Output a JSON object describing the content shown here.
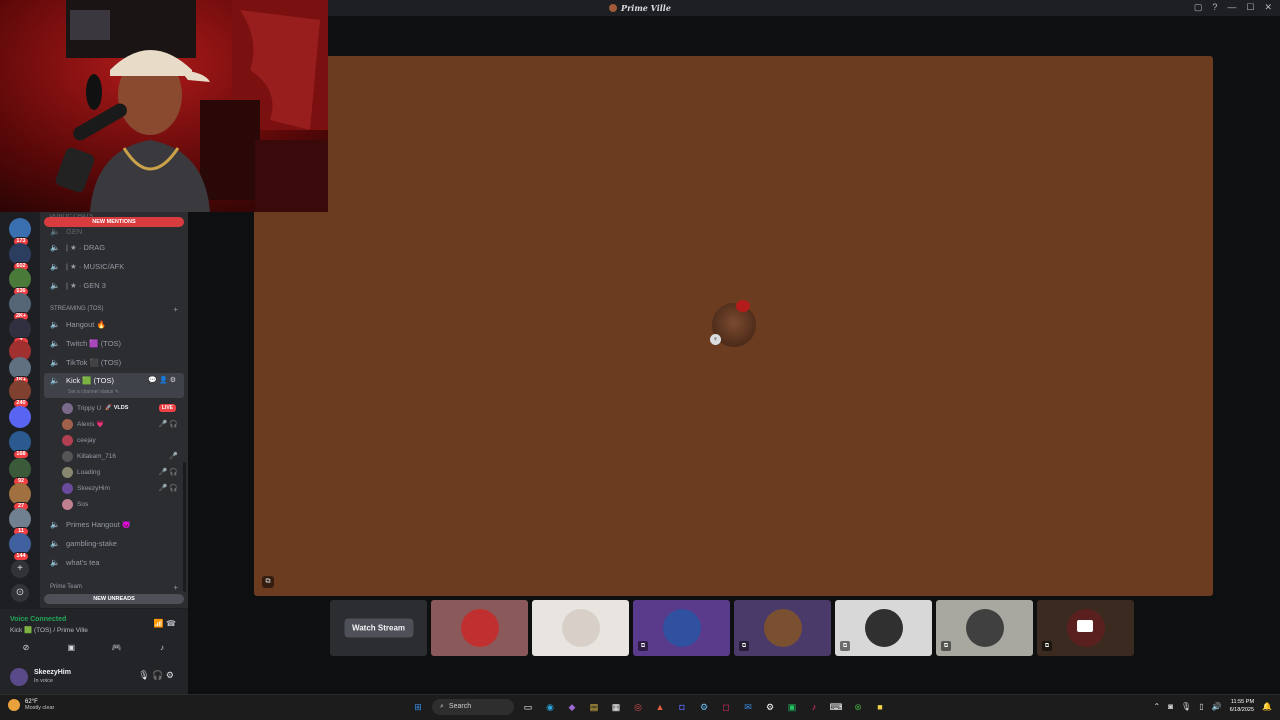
{
  "window": {
    "title": "Prime Ville",
    "controls": [
      "▢",
      "?",
      "—",
      "☐",
      "✕"
    ]
  },
  "sidebar": {
    "pill_mentions": "NEW MENTIONS",
    "pill_unreads": "NEW UNREADS",
    "cut_category_top": "PUBLIC CHATS",
    "cut_channel_top": "GEN",
    "channels_top": [
      {
        "name": "| ★ · DRAG"
      },
      {
        "name": "| ★ · MUSIC/AFK"
      },
      {
        "name": "| ★ · GEN 3"
      }
    ],
    "category": "STREAMING (TOS)",
    "category_plus": "+",
    "streaming_channels": [
      {
        "name": "Hangout 🔥"
      },
      {
        "name": "Twitch 🟪 (TOS)"
      },
      {
        "name": "TikTok ⬛ (TOS)"
      }
    ],
    "active_channel": {
      "name": "Kick 🟩 (TOS)",
      "status": "Set a channel status ✎",
      "icons": "💬 👤 ⚙"
    },
    "voice_users": [
      {
        "name": "Trippy U",
        "tag": "🚀 VLDS",
        "live": "LIVE",
        "avatar": "#7a6a8a"
      },
      {
        "name": "Alexis 💗",
        "icons": "🎤 🎧",
        "avatar": "#a0604a"
      },
      {
        "name": "ceejay",
        "avatar": "#b04050"
      },
      {
        "name": "Killakam_716",
        "icons": "🎤",
        "avatar": "#555"
      },
      {
        "name": "Loading",
        "icons": "🎤 🎧",
        "avatar": "#888870"
      },
      {
        "name": "SkeezyHim",
        "icons": "🎤 🎧",
        "avatar": "#6a4a9a"
      },
      {
        "name": "Sos",
        "avatar": "#c08090"
      }
    ],
    "channels_bottom": [
      {
        "name": "Primes Hangout 😈"
      },
      {
        "name": "gambling-stake"
      },
      {
        "name": "what's tea"
      }
    ],
    "category_bottom": "Prime Team"
  },
  "servers": [
    {
      "badge": "173",
      "color": "#3a6fb0"
    },
    {
      "badge": "602",
      "color": "#2c3e60"
    },
    {
      "badge": "536",
      "color": "#4a7a3a"
    },
    {
      "badge": "2K+",
      "color": "#556677"
    },
    {
      "badge": "7",
      "color": "#303040"
    },
    {
      "badge": "",
      "color": "#a03030"
    },
    {
      "badge": "1K+",
      "color": "#607080"
    },
    {
      "badge": "240",
      "color": "#804030"
    },
    {
      "badge": "",
      "color": "#5865f2"
    },
    {
      "badge": "168",
      "color": "#2a5a90"
    },
    {
      "badge": "92",
      "color": "#3a5a3a"
    },
    {
      "badge": "27",
      "color": "#a07040"
    },
    {
      "badge": "11",
      "color": "#708090"
    },
    {
      "badge": "144",
      "color": "#4060a0"
    }
  ],
  "voice_panel": {
    "status": "Voice Connected",
    "channel": "Kick 🟩 (TOS) / Prime Ville",
    "right_icons": "📶 ☎"
  },
  "user_panel": {
    "name": "SkeezyHim",
    "status": "In voice",
    "icons": "🎙 🎧 ⚙"
  },
  "stage": {
    "watch_stream": "Watch Stream",
    "tiles": [
      {
        "bg": "#8a5a5a",
        "face": "#c03030"
      },
      {
        "bg": "#e8e4e0",
        "face": "#d8d0c8"
      },
      {
        "bg": "#5a3a8a",
        "face": "#3050a0"
      },
      {
        "bg": "#4a3a6a",
        "face": "#7a5030"
      },
      {
        "bg": "#d8d8d8",
        "face": "#303030"
      },
      {
        "bg": "#a8a8a0",
        "face": "#404040"
      },
      {
        "bg": "#3a2a20",
        "face": "#5a2020"
      }
    ]
  },
  "taskbar": {
    "temp": "62°F",
    "weather": "Mostly clear",
    "search": "Search",
    "time": "11:55 PM",
    "date": "6/18/2025"
  }
}
